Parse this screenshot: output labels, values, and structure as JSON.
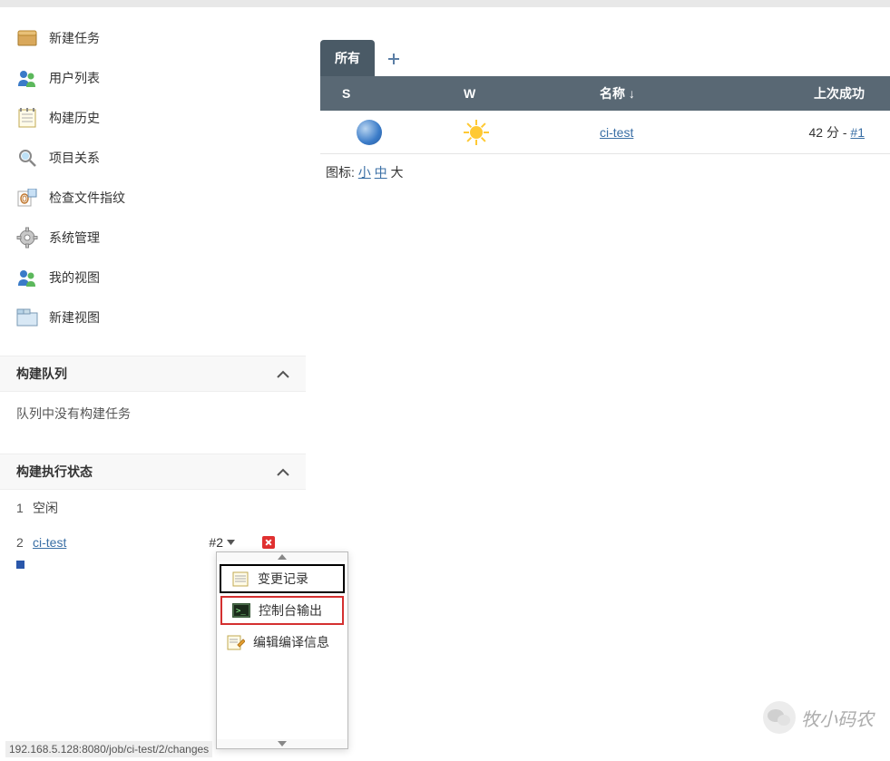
{
  "sidebar": {
    "items": [
      {
        "label": "新建任务"
      },
      {
        "label": "用户列表"
      },
      {
        "label": "构建历史"
      },
      {
        "label": "项目关系"
      },
      {
        "label": "检查文件指纹"
      },
      {
        "label": "系统管理"
      },
      {
        "label": "我的视图"
      },
      {
        "label": "新建视图"
      }
    ]
  },
  "queue": {
    "title": "构建队列",
    "empty": "队列中没有构建任务"
  },
  "executor": {
    "title": "构建执行状态",
    "rows": [
      {
        "num": "1",
        "label": "空闲"
      },
      {
        "num": "2",
        "label": "ci-test",
        "build": "#2"
      }
    ]
  },
  "tabs": {
    "all": "所有"
  },
  "table": {
    "headers": {
      "s": "S",
      "w": "W",
      "name": "名称 ↓",
      "last": "上次成功"
    },
    "row": {
      "name": "ci-test",
      "last_prefix": "42 分 - ",
      "last_link": "#1"
    }
  },
  "legend": {
    "prefix": "图标: ",
    "small": "小",
    "medium": "中",
    "large": " 大"
  },
  "dropdown": {
    "changes": "变更记录",
    "console": "控制台输出",
    "edit": "编辑编译信息"
  },
  "watermark": "牧小码农",
  "status_url": "192.168.5.128:8080/job/ci-test/2/changes"
}
